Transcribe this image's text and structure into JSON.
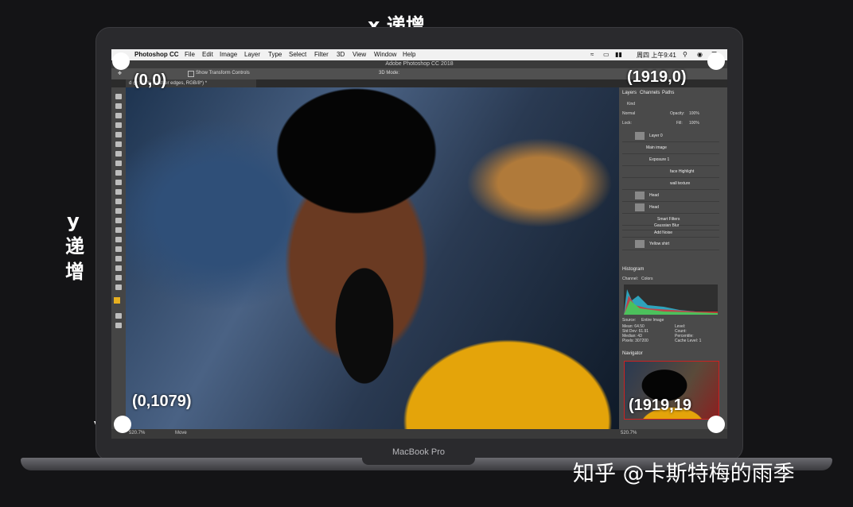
{
  "annotations": {
    "x_axis_label": "x 递增",
    "y_axis_label": [
      "y",
      "递",
      "增"
    ],
    "coords": {
      "top_left": "(0,0)",
      "top_right": "(1919,0)",
      "bottom_left": "(0,1079)",
      "bottom_right": "(1919,19"
    }
  },
  "laptop": {
    "brand": "MacBook Pro"
  },
  "watermark": "知乎 @卡斯特梅的雨季",
  "menubar": {
    "app": "Photoshop CC",
    "items": [
      "File",
      "Edit",
      "Image",
      "Layer",
      "Type",
      "Select",
      "Filter",
      "3D",
      "View",
      "Window",
      "Help"
    ],
    "clock": "周四 上午9:41"
  },
  "photoshop": {
    "window_title": "Adobe Photoshop CC 2018",
    "option_bar": {
      "show_transform": "Show Transform Controls",
      "mode_3d": "3D Mode:"
    },
    "doc_tab": "d @ 521% (feather edges, RGB/8*) *",
    "status": {
      "zoom": "520.7%",
      "tool": "Move",
      "nav_zoom": "520.7%"
    },
    "layers_panel": {
      "tabs": [
        "Layers",
        "Channels",
        "Paths"
      ],
      "kind": "Kind",
      "blend_mode": "Normal",
      "opacity_label": "Opacity:",
      "opacity": "100%",
      "lock_label": "Lock:",
      "fill_label": "Fill:",
      "fill": "100%",
      "layers": [
        "Layer 0",
        "Main image",
        "Exposure 1",
        "face Highlight",
        "wall texture",
        "Head",
        "Head",
        "Smart Filters",
        "Gaussian Blur",
        "Add Noise",
        "Yellow shirt"
      ]
    },
    "histogram_panel": {
      "title": "Histogram",
      "channel_label": "Channel:",
      "channel": "Colors",
      "source_label": "Source:",
      "source": "Entire Image",
      "stats": [
        {
          "k": "Mean:",
          "v": "64.50"
        },
        {
          "k": "Std Dev:",
          "v": "61.91"
        },
        {
          "k": "Median:",
          "v": "43"
        },
        {
          "k": "Pixels:",
          "v": "307200"
        }
      ],
      "stats_right": [
        "Level:",
        "Count:",
        "Percentile:",
        "Cache Level: 1"
      ]
    },
    "navigator_panel": {
      "title": "Navigator"
    }
  }
}
